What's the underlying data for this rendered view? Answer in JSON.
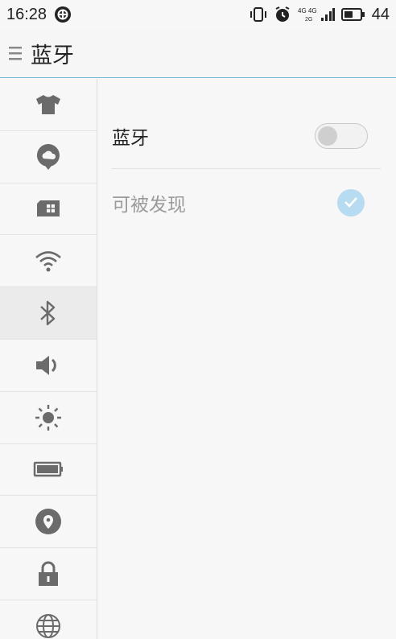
{
  "status_bar": {
    "time": "16:28",
    "network_label_1": "4G 4G",
    "network_label_2": "2G",
    "battery": "44"
  },
  "header": {
    "title": "蓝牙"
  },
  "sidebar": {
    "items": [
      {
        "icon": "theme-shirt-icon"
      },
      {
        "icon": "cloud-account-icon"
      },
      {
        "icon": "sim-card-icon"
      },
      {
        "icon": "wifi-icon"
      },
      {
        "icon": "bluetooth-icon",
        "selected": true
      },
      {
        "icon": "volume-icon"
      },
      {
        "icon": "brightness-icon"
      },
      {
        "icon": "battery-icon"
      },
      {
        "icon": "location-icon"
      },
      {
        "icon": "lock-icon"
      },
      {
        "icon": "globe-icon"
      }
    ]
  },
  "settings": {
    "bluetooth_label": "蓝牙",
    "bluetooth_on": false,
    "discoverable_label": "可被发现",
    "discoverable_checked": true
  },
  "colors": {
    "accent": "#6fb8d8",
    "check_bg": "#b7dcf2",
    "icon_gray": "#6b6b6b"
  }
}
